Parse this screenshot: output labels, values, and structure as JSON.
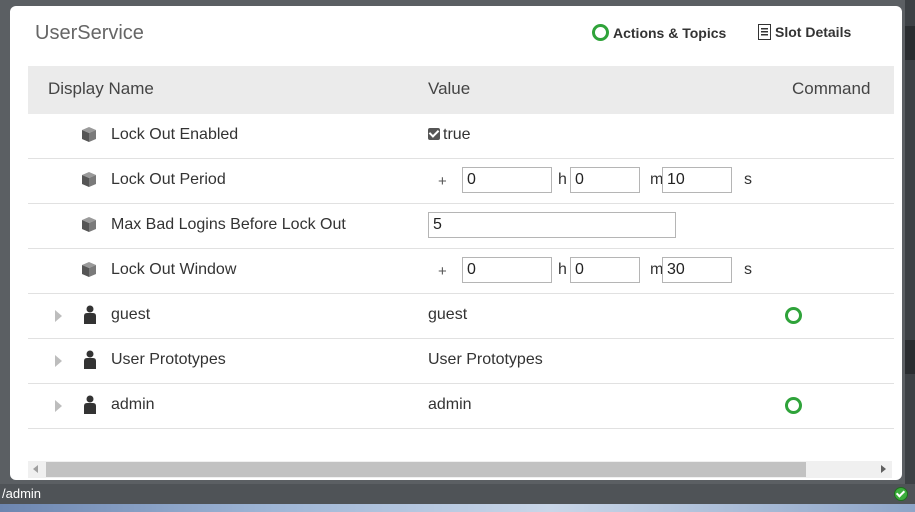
{
  "window": {
    "title": "UserService"
  },
  "header_actions": {
    "actions_topics": "Actions & Topics",
    "slot_details": "Slot Details"
  },
  "columns": {
    "display_name": "Display Name",
    "value": "Value",
    "command": "Command"
  },
  "properties": {
    "lock_out_enabled": {
      "name": "Lock Out Enabled",
      "value": "true",
      "checked": true
    },
    "lock_out_period": {
      "name": "Lock Out Period",
      "sign": "+",
      "h": "0",
      "m": "0",
      "s": "10",
      "h_unit": "h",
      "m_unit": "m",
      "s_unit": "s"
    },
    "max_bad_logins": {
      "name": "Max Bad Logins Before Lock Out",
      "value": "5"
    },
    "lock_out_window": {
      "name": "Lock Out Window",
      "sign": "+",
      "h": "0",
      "m": "0",
      "s": "30",
      "h_unit": "h",
      "m_unit": "m",
      "s_unit": "s"
    }
  },
  "users": [
    {
      "name": "guest",
      "value": "guest",
      "has_command": true
    },
    {
      "name": "User Prototypes",
      "value": "User Prototypes",
      "has_command": false
    },
    {
      "name": "admin",
      "value": "admin",
      "has_command": true
    }
  ],
  "status_bar": {
    "path": "/admin",
    "status": "ok"
  },
  "colors": {
    "accent_green": "#2fa33a",
    "header_bg": "#ebebeb",
    "status_bar_bg": "#4f5357"
  },
  "icons": [
    "ring-icon",
    "document-icon",
    "property-icon",
    "user-icon",
    "expand-arrow-icon",
    "checkbox-icon",
    "status-ok-icon"
  ]
}
